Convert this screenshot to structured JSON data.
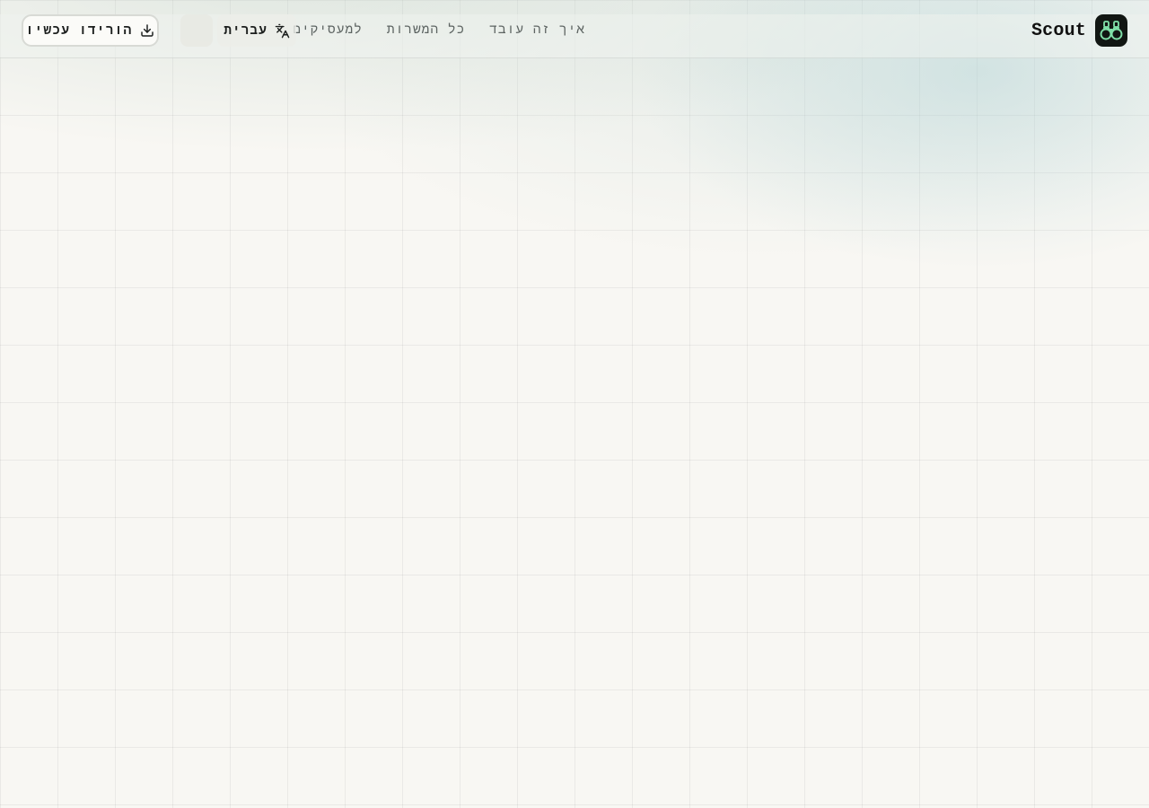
{
  "brand": {
    "name": "Scout",
    "logo_icon": "binoculars-icon",
    "logo_bg": "#111613",
    "logo_accent": "#7fe0a8"
  },
  "nav": {
    "links": [
      {
        "label": "איך זה עובד"
      },
      {
        "label": "כל המשרות"
      },
      {
        "label": "למעסיקים"
      }
    ]
  },
  "language": {
    "label": "עברית",
    "icon": "translate-icon"
  },
  "theme_toggle": {
    "icon": "blank-button"
  },
  "download": {
    "label": "הורידו עכשיו",
    "icon": "download-icon"
  },
  "colors": {
    "background": "#f8f7f3",
    "grid_line": "#e6e6e1",
    "text_primary": "#111111",
    "text_muted": "#5d6462"
  }
}
